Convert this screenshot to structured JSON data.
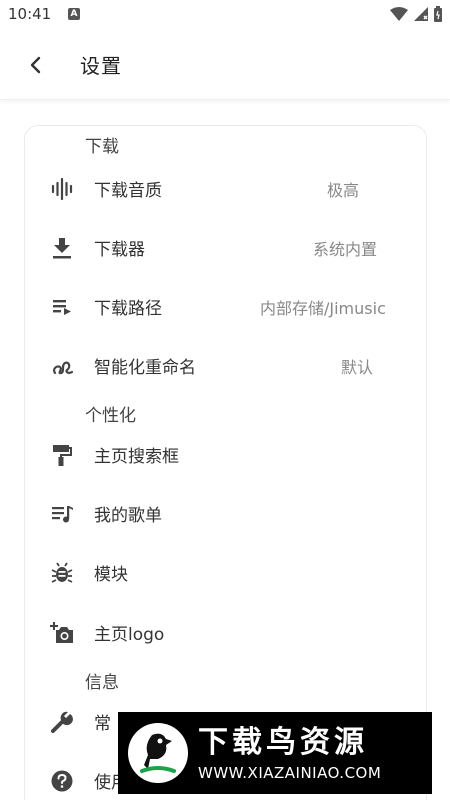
{
  "status_bar": {
    "time": "10:41",
    "notification_letter": "A"
  },
  "header": {
    "title": "设置"
  },
  "sections": {
    "download": {
      "title": "下载",
      "items": [
        {
          "label": "下载音质",
          "value": "极高",
          "icon": "waveform-icon"
        },
        {
          "label": "下载器",
          "value": "系统内置",
          "icon": "download-icon"
        },
        {
          "label": "下载路径",
          "value": "内部存储/Jimusic",
          "icon": "playlist-play-icon"
        },
        {
          "label": "智能化重命名",
          "value": "默认",
          "icon": "signature-icon"
        }
      ]
    },
    "personalize": {
      "title": "个性化",
      "items": [
        {
          "label": "主页搜索框",
          "icon": "paint-roller-icon"
        },
        {
          "label": "我的歌单",
          "icon": "music-list-icon"
        },
        {
          "label": "模块",
          "icon": "bug-icon"
        },
        {
          "label": "主页logo",
          "icon": "add-photo-icon"
        }
      ]
    },
    "info": {
      "title": "信息",
      "items": [
        {
          "label": "常",
          "icon": "wrench-icon"
        },
        {
          "label": "使用",
          "icon": "help-circle-icon"
        }
      ]
    }
  },
  "watermark": {
    "title": "下载鸟资源",
    "url": "WWW.XIAZAINIAO.COM"
  }
}
